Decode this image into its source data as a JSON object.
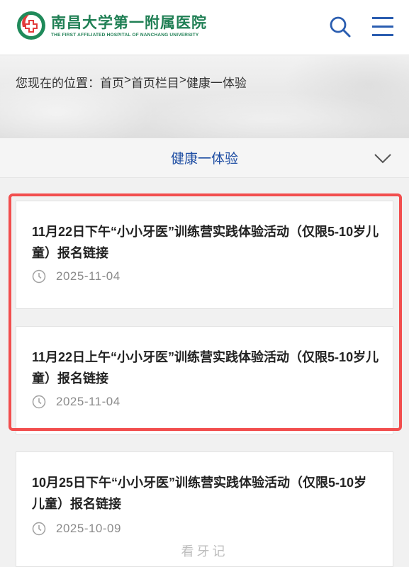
{
  "header": {
    "logo_cn": "南昌大学第一附属医院",
    "logo_en": "THE FIRST AFFILIATED HOSPITAL OF NANCHANG UNIVERSITY",
    "search_icon": "search-icon",
    "menu_icon": "menu-icon",
    "brand_color": "#1f7f54",
    "accent_color": "#2a5db0"
  },
  "breadcrumb": {
    "prefix": "您现在的位置：",
    "items": [
      "首页",
      "首页栏目",
      "健康一体验"
    ],
    "separator": " > "
  },
  "section": {
    "title": "健康一体验",
    "title_color": "#1f4ea3",
    "toggle_icon": "chevron-down-icon"
  },
  "articles": [
    {
      "title": "11月22日下午“小小牙医”训练营实践体验活动（仅限5-10岁儿童）报名链接",
      "date": "2025-11-04"
    },
    {
      "title": "11月22日上午“小小牙医”训练营实践体验活动（仅限5-10岁儿童）报名链接",
      "date": "2025-11-04"
    },
    {
      "title": "10月25日下午“小小牙医”训练营实践体验活动（仅限5-10岁儿童）报名链接",
      "date": "2025-10-09"
    }
  ],
  "highlight_color": "#f24e4e",
  "watermark": "看牙记"
}
